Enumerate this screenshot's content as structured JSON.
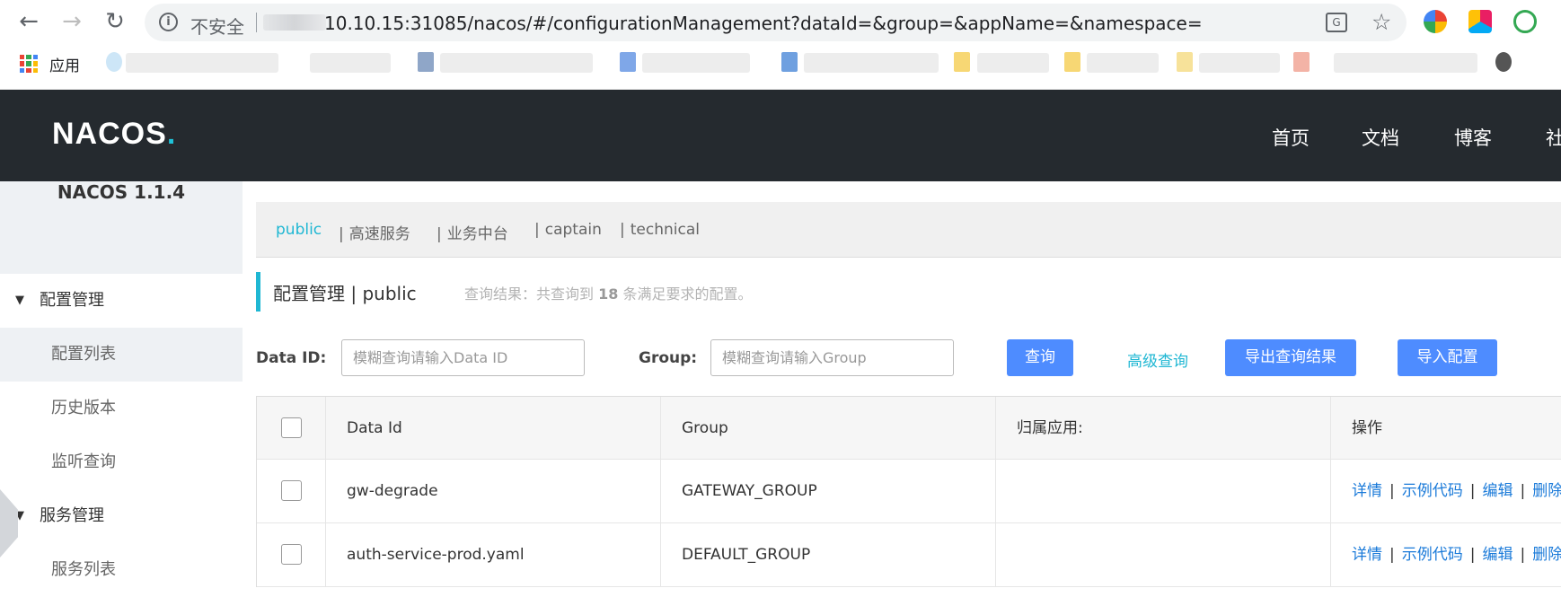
{
  "browser": {
    "insecure_label": "不安全",
    "url": "10.10.15:31085/nacos/#/configurationManagement?dataId=&group=&appName=&namespace=",
    "bookmarks_apps_label": "应用"
  },
  "header": {
    "logo_prefix": "NAC",
    "logo_c": "O",
    "logo_suffix": "S",
    "logo_dot": ".",
    "nav": [
      "首页",
      "文档",
      "博客",
      "社"
    ]
  },
  "sidebar": {
    "version": "NACOS 1.1.4",
    "groups": [
      {
        "label": "配置管理",
        "items": [
          "配置列表",
          "历史版本",
          "监听查询"
        ]
      },
      {
        "label": "服务管理",
        "items": [
          "服务列表"
        ]
      }
    ]
  },
  "namespaces": {
    "items": [
      "public",
      "高速服务",
      "业务中台",
      "captain",
      "technical"
    ],
    "pipe": "|"
  },
  "title": {
    "section": "配置管理",
    "separator": "|",
    "namespace": "public",
    "result_prefix": "查询结果：共查询到",
    "result_count": "18",
    "result_suffix": "条满足要求的配置。"
  },
  "search": {
    "dataid_label": "Data ID:",
    "dataid_placeholder": "模糊查询请输入Data ID",
    "group_label": "Group:",
    "group_placeholder": "模糊查询请输入Group",
    "query_button": "查询",
    "advanced_link": "高级查询",
    "export_button": "导出查询结果",
    "import_button": "导入配置"
  },
  "table": {
    "columns": [
      "Data Id",
      "Group",
      "归属应用:",
      "操作"
    ],
    "rows": [
      {
        "data_id": "gw-degrade",
        "group": "GATEWAY_GROUP",
        "app": ""
      },
      {
        "data_id": "auth-service-prod.yaml",
        "group": "DEFAULT_GROUP",
        "app": ""
      }
    ],
    "ops": [
      "详情",
      "示例代码",
      "编辑",
      "删除"
    ],
    "ops_sep": "|"
  },
  "colors": {
    "accent": "#1fb7d3",
    "primary_button": "#4e8cff",
    "header_bg": "#252a2f",
    "link": "#1a7ad9"
  }
}
